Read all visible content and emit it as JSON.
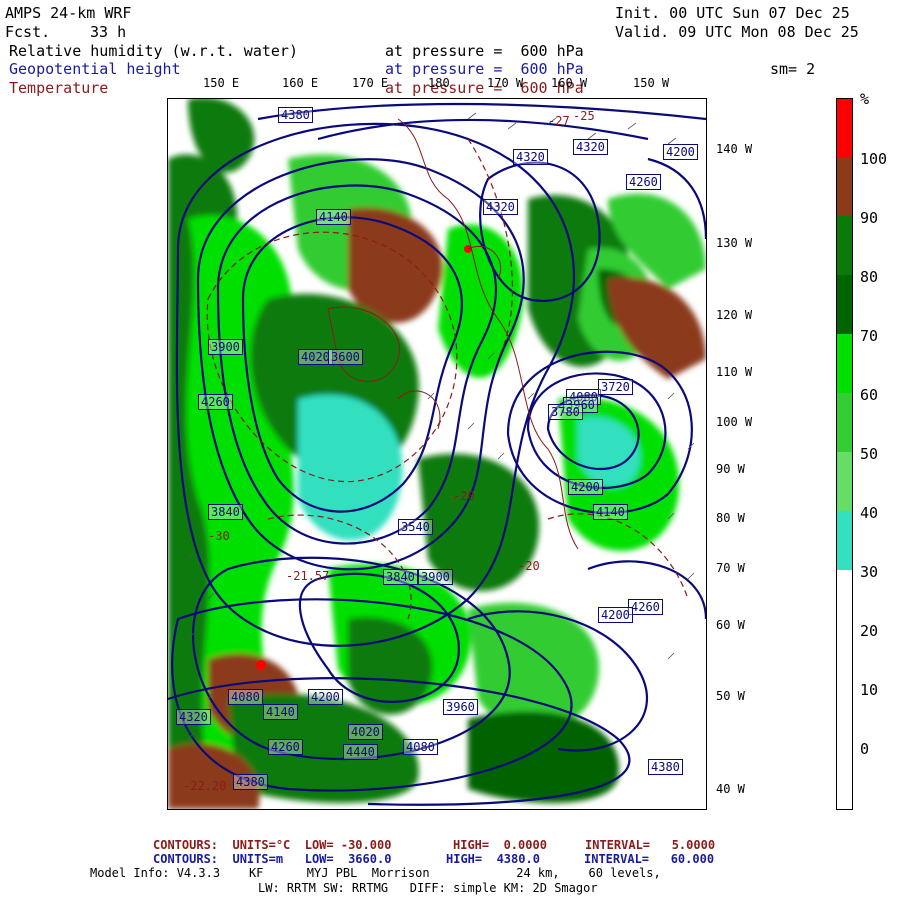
{
  "header": {
    "model": "AMPS 24-km WRF",
    "fcst_label": "Fcst.",
    "fcst_value": "33 h",
    "init": "Init. 00 UTC Sun 07 Dec 25",
    "valid": "Valid. 09 UTC Mon 08 Dec 25",
    "fields": [
      {
        "name": "Relative humidity (w.r.t. water)",
        "level": "at pressure =  600 hPa",
        "color": "#000000"
      },
      {
        "name": "Geopotential height",
        "level": "at pressure =  600 hPa",
        "color": "#1a1aa0"
      },
      {
        "name": "Temperature",
        "level": "at pressure =  600 hPa",
        "color": "#8b1a1a"
      }
    ],
    "smoothing": "sm= 2"
  },
  "map": {
    "lon_top": [
      "150 E",
      "160 E",
      "170 E",
      "180",
      "170 W",
      "160 W",
      "150 W"
    ],
    "lon_right": [
      "140 W",
      "130 W",
      "120 W",
      "110 W",
      "100 W",
      "90 W",
      "80 W",
      "70 W",
      "60 W",
      "50 W",
      "40 W"
    ],
    "height_contour_labels": [
      "4380",
      "4320",
      "4320",
      "4260",
      "4200",
      "4140",
      "4080",
      "4020",
      "3960",
      "3900",
      "3840",
      "3780",
      "3720",
      "3600",
      "3540",
      "4080",
      "4140",
      "4200",
      "4260",
      "4320",
      "4380",
      "4440",
      "4320",
      "4380",
      "4260",
      "4200",
      "3960",
      "3900",
      "3840",
      "4080",
      "4020",
      "4140",
      "4200",
      "4260"
    ],
    "temp_labels": [
      "-25",
      "-27",
      "-20",
      "-21.57",
      "-30",
      "-20",
      "-22.20"
    ],
    "colors": {
      "height_line": "#0a0a7a",
      "temp_line": "#8b1a1a",
      "coast": "#8b1a1a"
    }
  },
  "colorbar": {
    "unit": "%",
    "ticks": [
      "100",
      "90",
      "80",
      "70",
      "60",
      "50",
      "40",
      "30",
      "20",
      "10",
      "0"
    ],
    "bins": [
      {
        "range": "95-100",
        "color": "#ff0000"
      },
      {
        "range": "90-95",
        "color": "#8b3a1a"
      },
      {
        "range": "80-90",
        "color": "#0a7a0a"
      },
      {
        "range": "70-80",
        "color": "#006400"
      },
      {
        "range": "60-70",
        "color": "#00e000"
      },
      {
        "range": "50-60",
        "color": "#33cc33"
      },
      {
        "range": "40-50",
        "color": "#66dd66"
      },
      {
        "range": "30-40",
        "color": "#33e0c0"
      },
      {
        "range": "0-30",
        "color": "#ffffff"
      }
    ]
  },
  "footer": {
    "contour1": {
      "label": "CONTOURS:  UNITS=°C  LOW= -30.000",
      "high": "HIGH=  0.0000",
      "interval": "INTERVAL=   5.0000",
      "color": "#8b1a1a"
    },
    "contour2": {
      "label": "CONTOURS:  UNITS=m   LOW=  3660.0",
      "high": "HIGH=  4380.0",
      "interval": "INTERVAL=   60.000",
      "color": "#1a1aa0"
    },
    "model_info": "Model Info: V4.3.3    KF      MYJ PBL  Morrison            24 km,    60 levels,",
    "model_info2": "LW: RRTM SW: RRTMG   DIFF: simple KM: 2D Smagor"
  }
}
